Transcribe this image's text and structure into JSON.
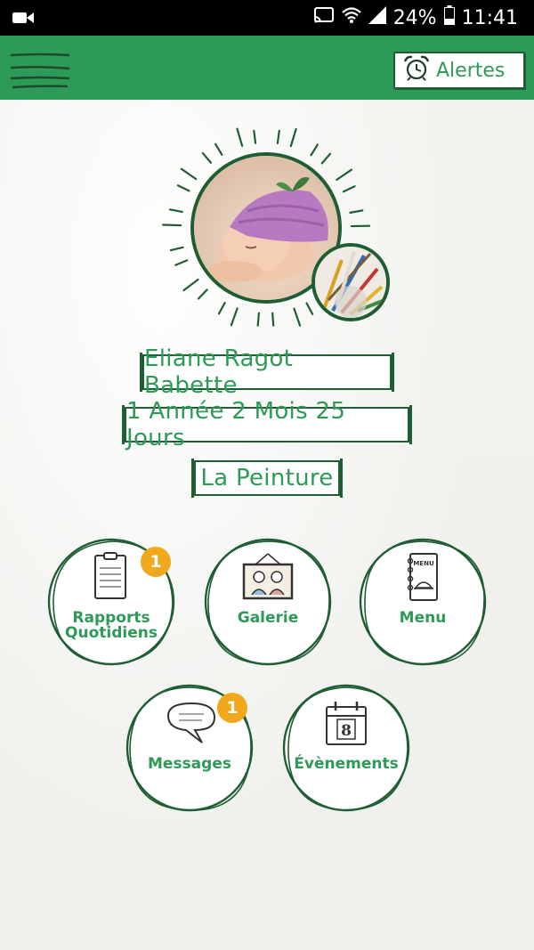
{
  "status_bar": {
    "battery": "24%",
    "time": "11:41"
  },
  "app_bar": {
    "menu_icon": "hamburger-icon",
    "alerts_label": "Alertes",
    "alerts_icon": "alarm-clock-icon"
  },
  "profile": {
    "name": "Eliane Ragot Babette",
    "age": "1 Année 2 Mois 25 Jours",
    "activity": "La Peinture"
  },
  "tiles": [
    {
      "label_line1": "Rapports",
      "label_line2": "Quotidiens",
      "icon": "clipboard-icon",
      "badge": "1"
    },
    {
      "label_line1": "Galerie",
      "label_line2": "",
      "icon": "picture-frame-icon",
      "badge": ""
    },
    {
      "label_line1": "Menu",
      "label_line2": "",
      "icon": "menu-book-icon",
      "badge": "",
      "icon_text": "MENU"
    },
    {
      "label_line1": "Messages",
      "label_line2": "",
      "icon": "speech-bubble-icon",
      "badge": "1"
    },
    {
      "label_line1": "Évènements",
      "label_line2": "",
      "icon": "calendar-icon",
      "badge": "",
      "icon_text": "8"
    }
  ],
  "colors": {
    "brand_green": "#2e9a57",
    "dark_green": "#1f5e33",
    "badge_orange": "#f2a81d"
  }
}
